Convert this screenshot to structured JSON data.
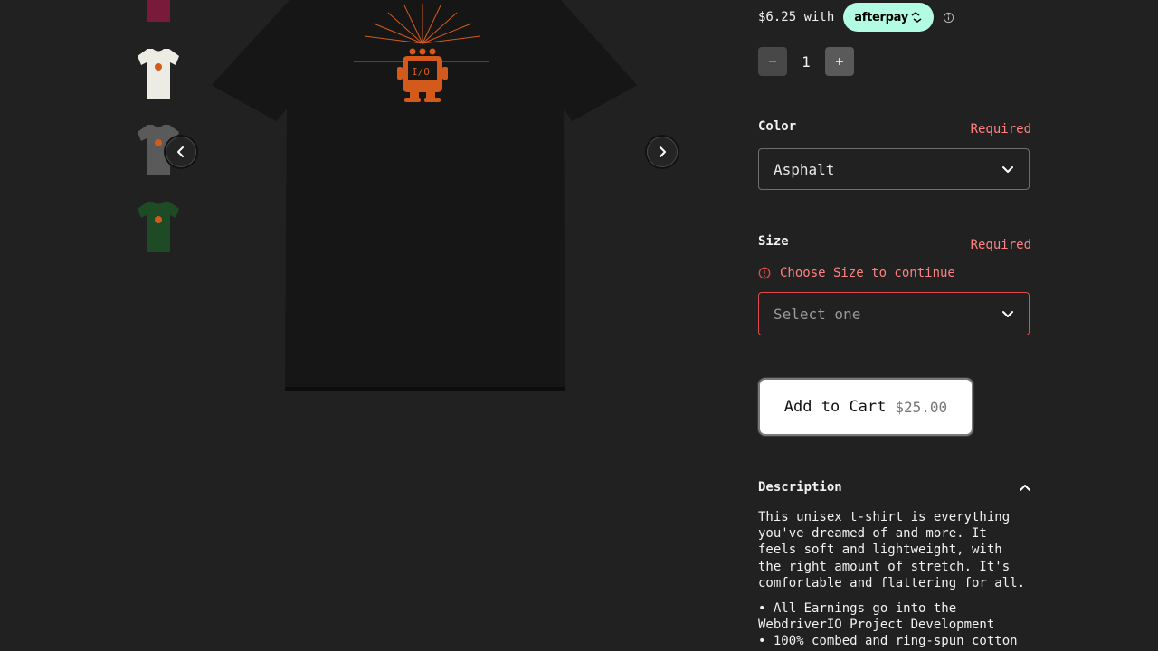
{
  "thumbnails": [
    {
      "name": "thumbnail-maroon",
      "color": "#7a1a3a"
    },
    {
      "name": "thumbnail-white",
      "color": "#ecebe4"
    },
    {
      "name": "thumbnail-asphalt",
      "color": "#555555"
    },
    {
      "name": "thumbnail-green",
      "color": "#1e4a26"
    }
  ],
  "gallery": {
    "shirt_color": "#151515",
    "print_color": "#d45a1c",
    "logo_text": "I/O",
    "prev_icon": "chevron-left-icon",
    "next_icon": "chevron-right-icon"
  },
  "afterpay": {
    "installment": "$6.25 with",
    "badge": "afterpay",
    "badge_color": "#b2fce4"
  },
  "quantity": {
    "value": "1"
  },
  "color_field": {
    "label": "Color",
    "required": "Required",
    "value": "Asphalt"
  },
  "size_field": {
    "label": "Size",
    "required": "Required",
    "error": "Choose Size to continue",
    "placeholder": "Select one"
  },
  "cart": {
    "label": "Add to Cart",
    "price": "$25.00"
  },
  "description": {
    "title": "Description",
    "body": "This unisex t-shirt is everything you've dreamed of and more. It feels soft and lightweight, with the right amount of stretch. It's comfortable and flattering for all.",
    "bullets": [
      "• All Earnings go into the WebdriverIO Project Development",
      "• 100% combed and ring-spun cotton"
    ]
  },
  "colors": {
    "error": "#ff8080",
    "required": "#ff8080",
    "background": "#212121"
  }
}
